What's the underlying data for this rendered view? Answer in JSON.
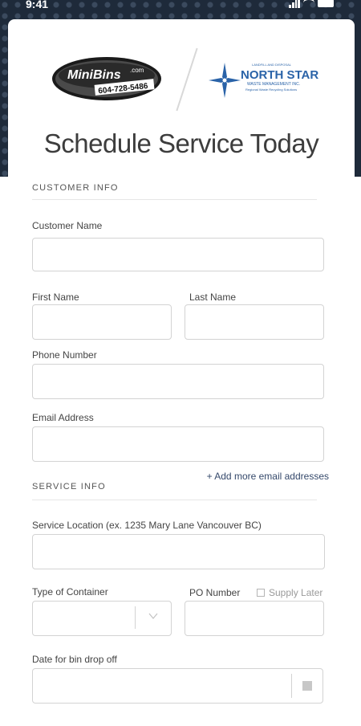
{
  "status": {
    "time": "9:41"
  },
  "logos": {
    "minibins_text": "MiniBins",
    "minibins_domain": ".com",
    "minibins_phone": "604-728-5486",
    "northstar_top": "LANDFILL AND DISPOSAL",
    "northstar_name": "NORTH STAR",
    "northstar_sub": "WASTE MANAGEMENT INC.",
    "northstar_tag": "Regional Waste Recycling Solutions"
  },
  "title": "Schedule Service Today",
  "customer_info": {
    "section": "CUSTOMER INFO",
    "customer_name": "Customer Name",
    "first_name": "First Name",
    "last_name": "Last Name",
    "phone": "Phone Number",
    "email": "Email Address",
    "add_email": "+ Add more email addresses"
  },
  "service_info": {
    "section": "SERVICE INFO",
    "location": "Service Location (ex. 1235 Mary Lane Vancouver BC)",
    "container": "Type of Container",
    "po_number": "PO Number",
    "supply_later": "Supply Later",
    "drop_date": "Date for bin drop off"
  }
}
